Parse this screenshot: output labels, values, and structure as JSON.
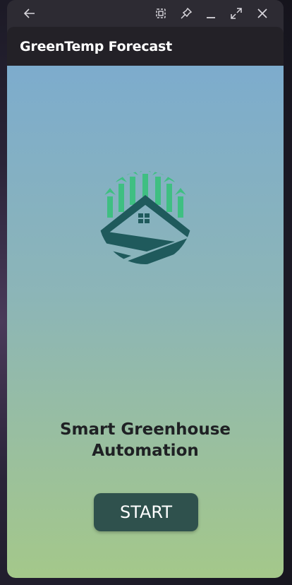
{
  "window": {
    "controls": {
      "back_icon": "arrow-left-icon",
      "screenshot_icon": "screenshot-icon",
      "pin_icon": "pin-icon",
      "minimize_icon": "minimize-icon",
      "maximize_icon": "maximize-icon",
      "close_icon": "close-icon"
    }
  },
  "appbar": {
    "title": "GreenTemp Forecast"
  },
  "main": {
    "logo_icon": "greenhouse-logo-icon",
    "headline_line1": "Smart Greenhouse",
    "headline_line2": "Automation",
    "start_label": "START"
  },
  "colors": {
    "gradient_top": "#7daccd",
    "gradient_bottom": "#a4c88a",
    "button": "#2f514d",
    "logo_green": "#3fbf82",
    "logo_dark": "#1f5a5c"
  }
}
